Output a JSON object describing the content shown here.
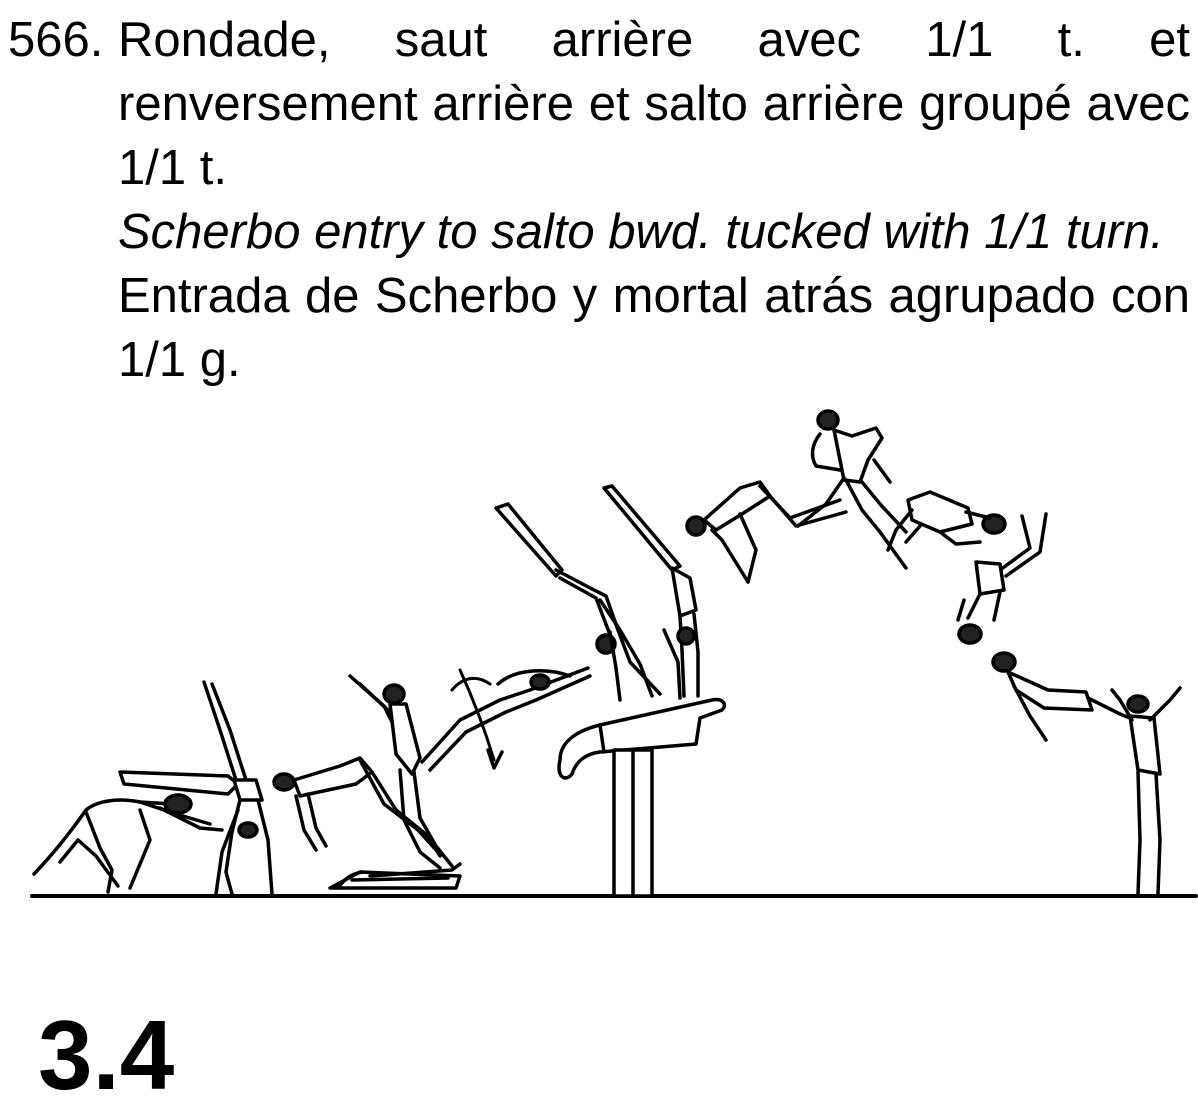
{
  "entry": {
    "number": "566.",
    "french": "Rondade, saut arrière avec 1/1 t. et renversement arrière et salto arrière groupé avec 1/1 t.",
    "english": "Scherbo entry to salto bwd. tucked with 1/1 turn.",
    "spanish": "Entrada de Scherbo y mortal atrás agrupado con 1/1 g."
  },
  "value": "3.4",
  "illustration": {
    "apparatus": [
      "springboard",
      "vaulting-table"
    ],
    "figure_count": 12
  }
}
